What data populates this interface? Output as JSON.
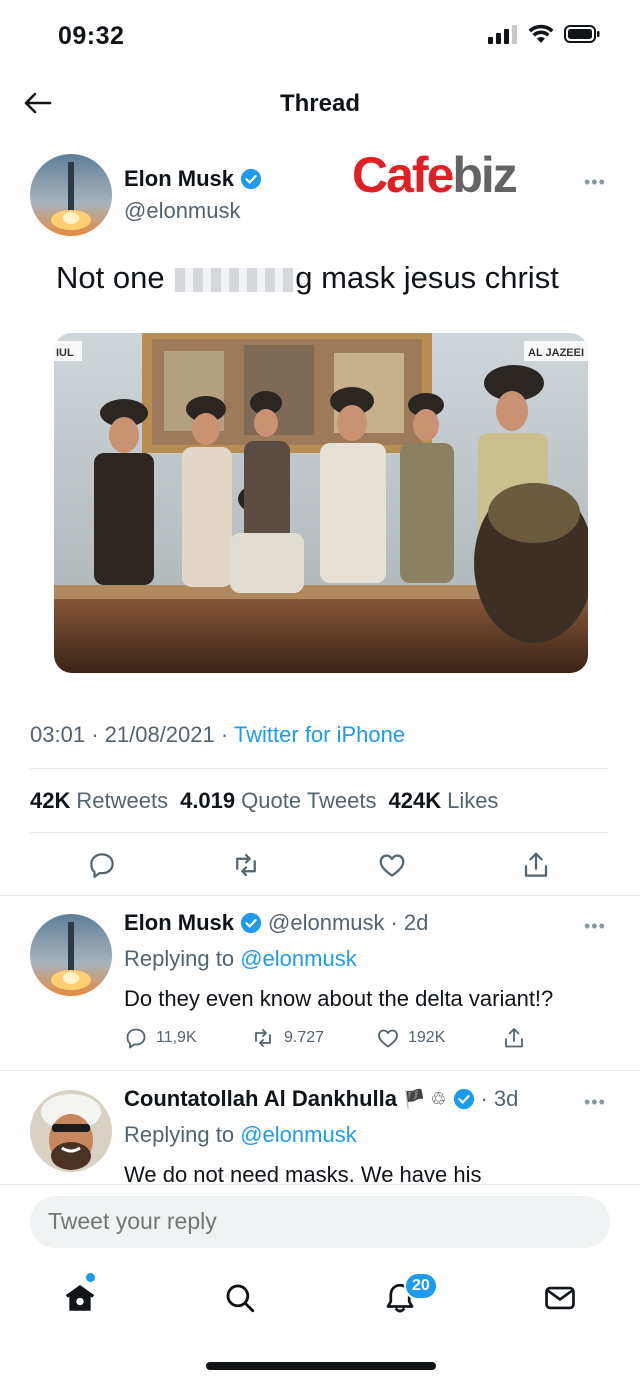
{
  "status_bar": {
    "time": "09:32"
  },
  "nav": {
    "title": "Thread"
  },
  "watermark": {
    "part1": "Cafe",
    "part2": "biz"
  },
  "main_tweet": {
    "author_name": "Elon Musk",
    "handle": "@elonmusk",
    "text_before": "Not one",
    "text_censored_tail": "g",
    "text_after": "mask jesus christ",
    "photo_label_left": "IUL",
    "photo_label_right": "AL JAZEEI",
    "time": "03:01",
    "date": "21/08/2021",
    "source": "Twitter for iPhone",
    "retweets_count": "42K",
    "retweets_label": "Retweets",
    "quotes_count": "4.019",
    "quotes_label": "Quote Tweets",
    "likes_count": "424K",
    "likes_label": "Likes"
  },
  "replies": [
    {
      "author_name": "Elon Musk",
      "handle": "@elonmusk",
      "age": "2d",
      "replying_prefix": "Replying to",
      "replying_to": "@elonmusk",
      "text": "Do they even know about the delta variant!?",
      "reply_count": "11,9K",
      "retweet_count": "9.727",
      "like_count": "192K"
    },
    {
      "author_name": "Countatollah Al Dankhulla",
      "emoji": "🏴 ♲",
      "age": "3d",
      "replying_prefix": "Replying to",
      "replying_to": "@elonmusk",
      "text": "We do not need masks. We have his"
    }
  ],
  "reply_box": {
    "placeholder": "Tweet your reply"
  },
  "tab_bar": {
    "notifications_badge": "20"
  },
  "colors": {
    "accent": "#1d9bf0",
    "text": "#0f1419",
    "muted": "#536471",
    "watermark_red": "#e01f26"
  },
  "icons": [
    "back-arrow-icon",
    "signal-icon",
    "wifi-icon",
    "battery-icon",
    "verified-icon",
    "more-icon",
    "reply-icon",
    "retweet-icon",
    "like-icon",
    "share-icon",
    "home-icon",
    "search-icon",
    "notifications-icon",
    "messages-icon"
  ]
}
